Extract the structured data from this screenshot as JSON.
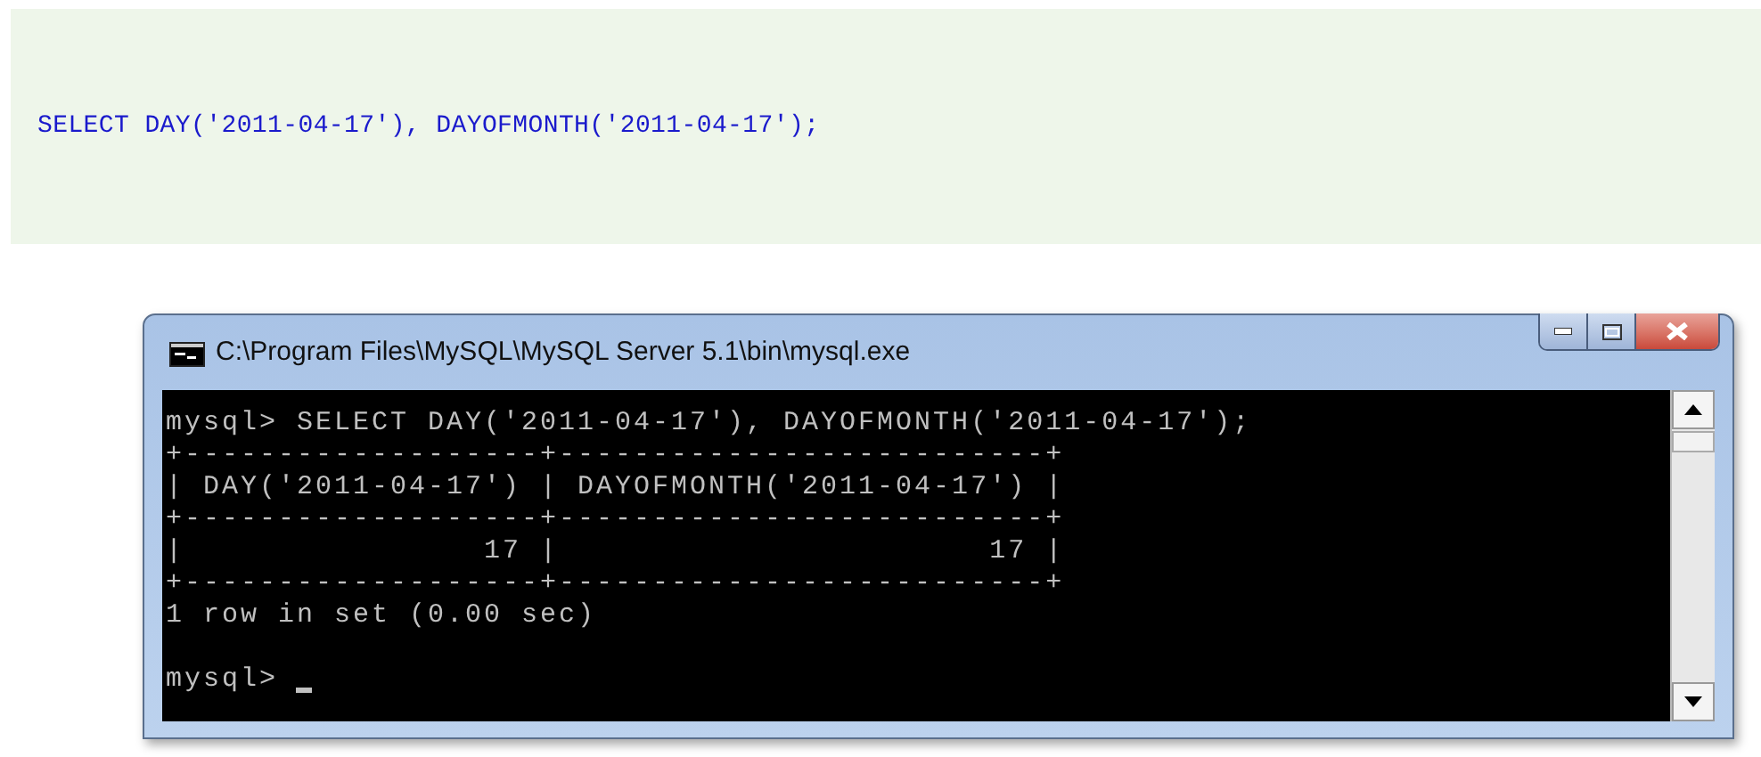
{
  "code_block": {
    "text": "SELECT DAY('2011-04-17'), DAYOFMONTH('2011-04-17');"
  },
  "window": {
    "title": "C:\\Program Files\\MySQL\\MySQL Server 5.1\\bin\\mysql.exe",
    "lines": [
      "mysql> SELECT DAY('2011-04-17'), DAYOFMONTH('2011-04-17');",
      "+-------------------+--------------------------+",
      "| DAY('2011-04-17') | DAYOFMONTH('2011-04-17') |",
      "+-------------------+--------------------------+",
      "|                17 |                       17 |",
      "+-------------------+--------------------------+",
      "1 row in set (0.00 sec)"
    ],
    "prompt": "mysql>",
    "cursor_visible": true
  }
}
